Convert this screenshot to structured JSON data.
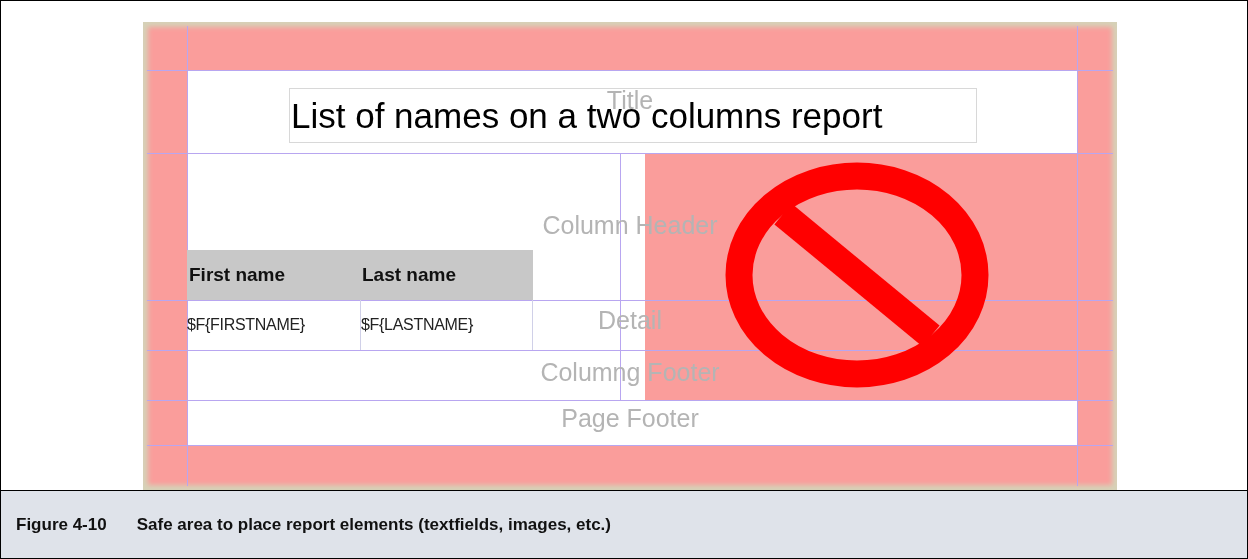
{
  "report_designer": {
    "band_labels": [
      "Title",
      "Column Header",
      "Detail",
      "Columng Footer",
      "Page Footer"
    ],
    "report_title": "List of names on a two columns report",
    "column_headers": [
      "First name",
      "Last name"
    ],
    "detail_fields": [
      "$F{FIRSTNAME}",
      "$F{LASTNAME}"
    ]
  },
  "caption": {
    "number": "Figure 4-10",
    "text": "Safe area to place report elements (textfields, images, etc.)"
  }
}
